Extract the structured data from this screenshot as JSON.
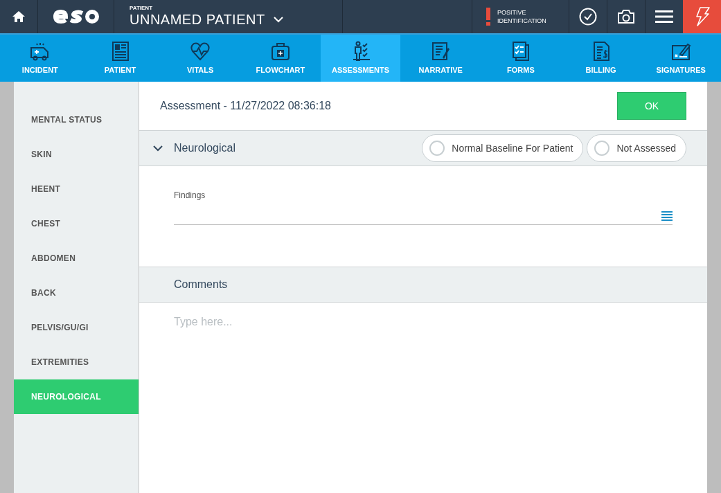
{
  "header": {
    "patient_label": "PATIENT",
    "patient_name": "UNNAMED PATIENT",
    "alert": "POSITIVE IDENTIFICATION"
  },
  "tabs": [
    {
      "label": "INCIDENT",
      "selected": false
    },
    {
      "label": "PATIENT",
      "selected": false
    },
    {
      "label": "VITALS",
      "selected": false
    },
    {
      "label": "FLOWCHART",
      "selected": false
    },
    {
      "label": "ASSESSMENTS",
      "selected": true
    },
    {
      "label": "NARRATIVE",
      "selected": false
    },
    {
      "label": "FORMS",
      "selected": false
    },
    {
      "label": "BILLING",
      "selected": false
    },
    {
      "label": "SIGNATURES",
      "selected": false
    }
  ],
  "sidebar": {
    "items": [
      {
        "label": "MENTAL STATUS",
        "selected": false
      },
      {
        "label": "SKIN",
        "selected": false
      },
      {
        "label": "HEENT",
        "selected": false
      },
      {
        "label": "CHEST",
        "selected": false
      },
      {
        "label": "ABDOMEN",
        "selected": false
      },
      {
        "label": "BACK",
        "selected": false
      },
      {
        "label": "PELVIS/GU/GI",
        "selected": false
      },
      {
        "label": "EXTREMITIES",
        "selected": false
      },
      {
        "label": "NEUROLOGICAL",
        "selected": true
      }
    ]
  },
  "assessment": {
    "title": "Assessment - 11/27/2022 08:36:18",
    "ok_button": "OK",
    "section": {
      "title": "Neurological",
      "expanded": true,
      "options": [
        {
          "label": "Normal Baseline For Patient",
          "checked": false
        },
        {
          "label": "Not Assessed",
          "checked": false
        }
      ],
      "findings_label": "Findings"
    },
    "comments": {
      "title": "Comments",
      "placeholder": "Type here..."
    }
  }
}
